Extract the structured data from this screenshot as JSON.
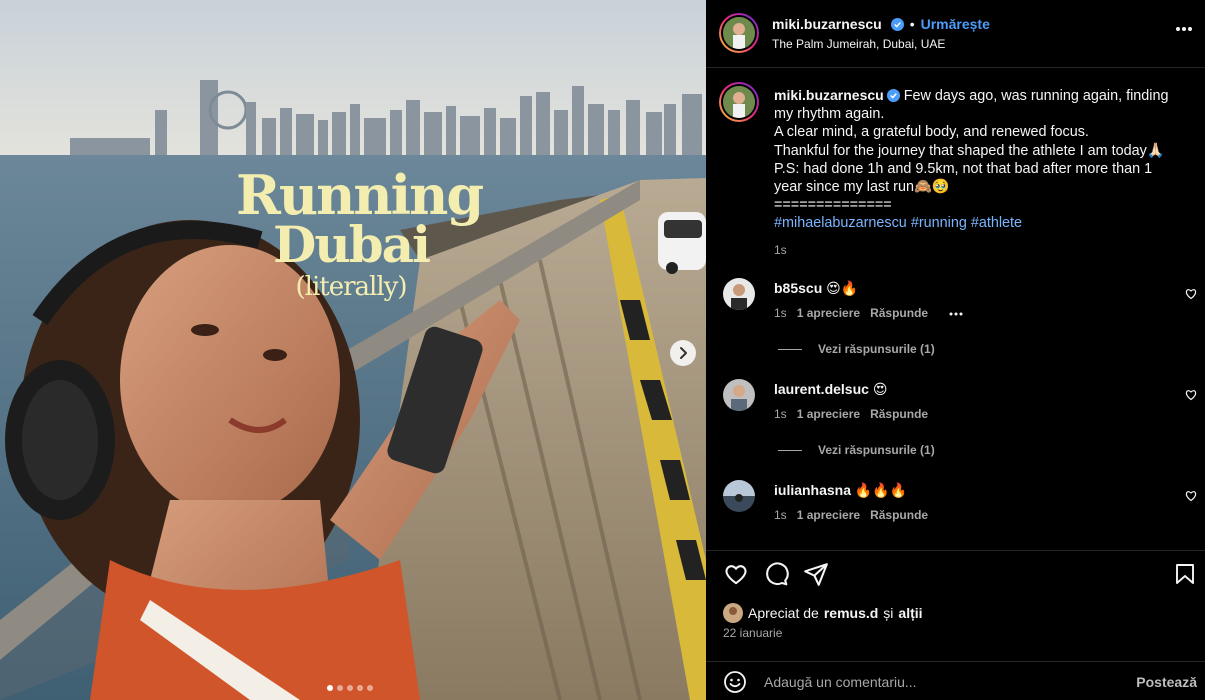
{
  "media": {
    "overlay_line1": "Running",
    "overlay_line2": "Dubai",
    "overlay_line3": "(literally)",
    "slide_count": 5,
    "active_slide": 1
  },
  "post_header": {
    "username": "miki.buzarnescu",
    "separator": "•",
    "follow_label": "Urmărește",
    "location": "The Palm Jumeirah, Dubai, UAE"
  },
  "caption": {
    "username": "miki.buzarnescu",
    "line1": "Few days ago, was running again, finding my rhythm again.",
    "line2": "A clear mind, a grateful body, and renewed focus.",
    "line3": "Thankful for the journey that shaped the athlete I am today🙏🏻",
    "line4": "P.S: had done 1h and 9.5km, not that bad after more than 1 year since my last run🙈🥹",
    "line5": "==============",
    "hashtag1": "#mihaelabuzarnescu",
    "hashtag2": "#running",
    "hashtag3": "#athlete",
    "time": "1s"
  },
  "comments": [
    {
      "username": "b85scu",
      "text": "😍🔥",
      "time": "1s",
      "likes": "1 apreciere",
      "reply": "Răspunde",
      "view_replies": "Vezi răspunsurile (1)"
    },
    {
      "username": "laurent.delsuc",
      "text": "😍",
      "time": "1s",
      "likes": "1 apreciere",
      "reply": "Răspunde",
      "view_replies": "Vezi răspunsurile (1)"
    },
    {
      "username": "iulianhasna",
      "text": "🔥🔥🔥",
      "time": "1s",
      "likes": "1 apreciere",
      "reply": "Răspunde"
    }
  ],
  "likes_line": {
    "prefix": "Apreciat de",
    "user": "remus.d",
    "mid": "și",
    "others": "alții"
  },
  "post_date": "22 ianuarie",
  "comment_box": {
    "placeholder": "Adaugă un comentariu...",
    "post_label": "Postează"
  },
  "colors": {
    "link_blue": "#4a9df8",
    "hashtag": "#7ab5ff",
    "overlay_text": "#f4edb0",
    "background": "#000000"
  }
}
